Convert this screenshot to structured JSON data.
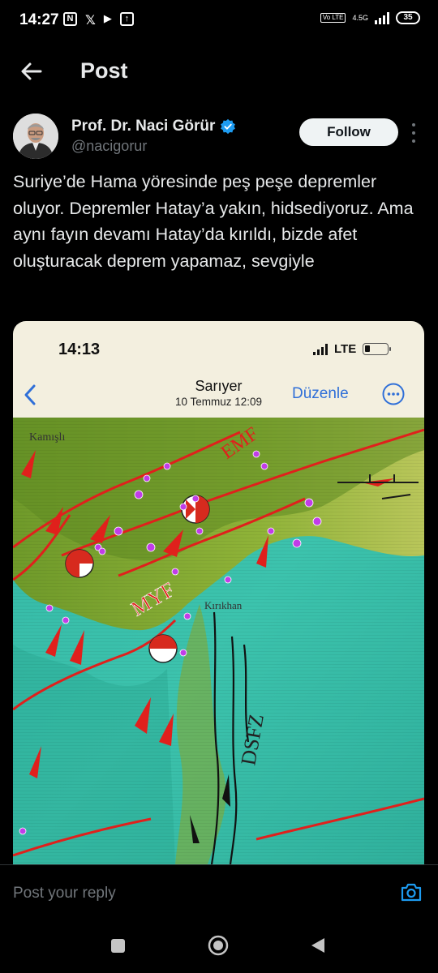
{
  "status_bar": {
    "time": "14:27",
    "volte": "Vo LTE",
    "network": "4.5G",
    "battery": "35"
  },
  "header": {
    "title": "Post"
  },
  "post": {
    "author_name": "Prof. Dr. Naci Görür",
    "handle": "@nacigorur",
    "follow_label": "Follow",
    "text": "Suriye’de Hama yöresinde peş peşe depremler oluyor. Depremler Hatay’a yakın, hidsediyoruz. Ama aynı fayın devamı Hatay’da kırıldı, bizde afet oluşturacak deprem yapamaz, sevgiyle"
  },
  "media": {
    "status_time": "14:13",
    "status_network": "LTE",
    "nav_title": "Sarıyer",
    "nav_subtitle": "10 Temmuz  12:09",
    "edit_label": "Düzenle",
    "map_labels": {
      "top_left": "Kamışlı",
      "emf": "EMF",
      "myf": "MYF",
      "city": "Kırıkhan",
      "dsfz": "DSFZ"
    }
  },
  "reply": {
    "placeholder": "Post your reply"
  },
  "colors": {
    "background": "#000000",
    "accent": "#1d9bf0",
    "fault_red": "#e0201c",
    "quake_purple": "#c13de8"
  },
  "icons": {
    "back": "arrow-left-icon",
    "verified": "verified-badge-icon",
    "more": "more-vertical-icon",
    "camera": "camera-icon"
  }
}
